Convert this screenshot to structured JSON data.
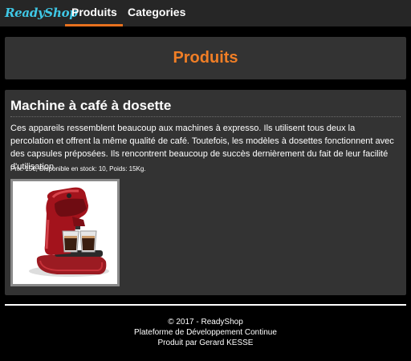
{
  "brand": {
    "name": "ReadyShop"
  },
  "nav": {
    "items": [
      {
        "label": "Produits"
      },
      {
        "label": "Categories"
      }
    ]
  },
  "hero": {
    "title": "Produits"
  },
  "product": {
    "title": "Machine à café à dosette",
    "description": "Ces appareils ressemblent beaucoup aux machines à expresso. Ils utilisent tous deux la percolation et offrent la même qualité de café. Toutefois, les modèles à dosettes fonctionnent avec des capsules préposées. Ils rencontrent beaucoup de succès dernièrement du fait de leur facilité d'utilisation.",
    "meta": "Prix: 15€, Disponible en stock: 10, Poids: 15Kg.",
    "image_name": "coffee-pod-machine"
  },
  "footer": {
    "line1": "© 2017 - ReadyShop",
    "line2": "Plateforme de Développement Continue",
    "line3": "Produit par Gerard KESSE"
  },
  "colors": {
    "accent": "#e8711e",
    "brand": "#3fc8e6",
    "panel": "#333333"
  }
}
